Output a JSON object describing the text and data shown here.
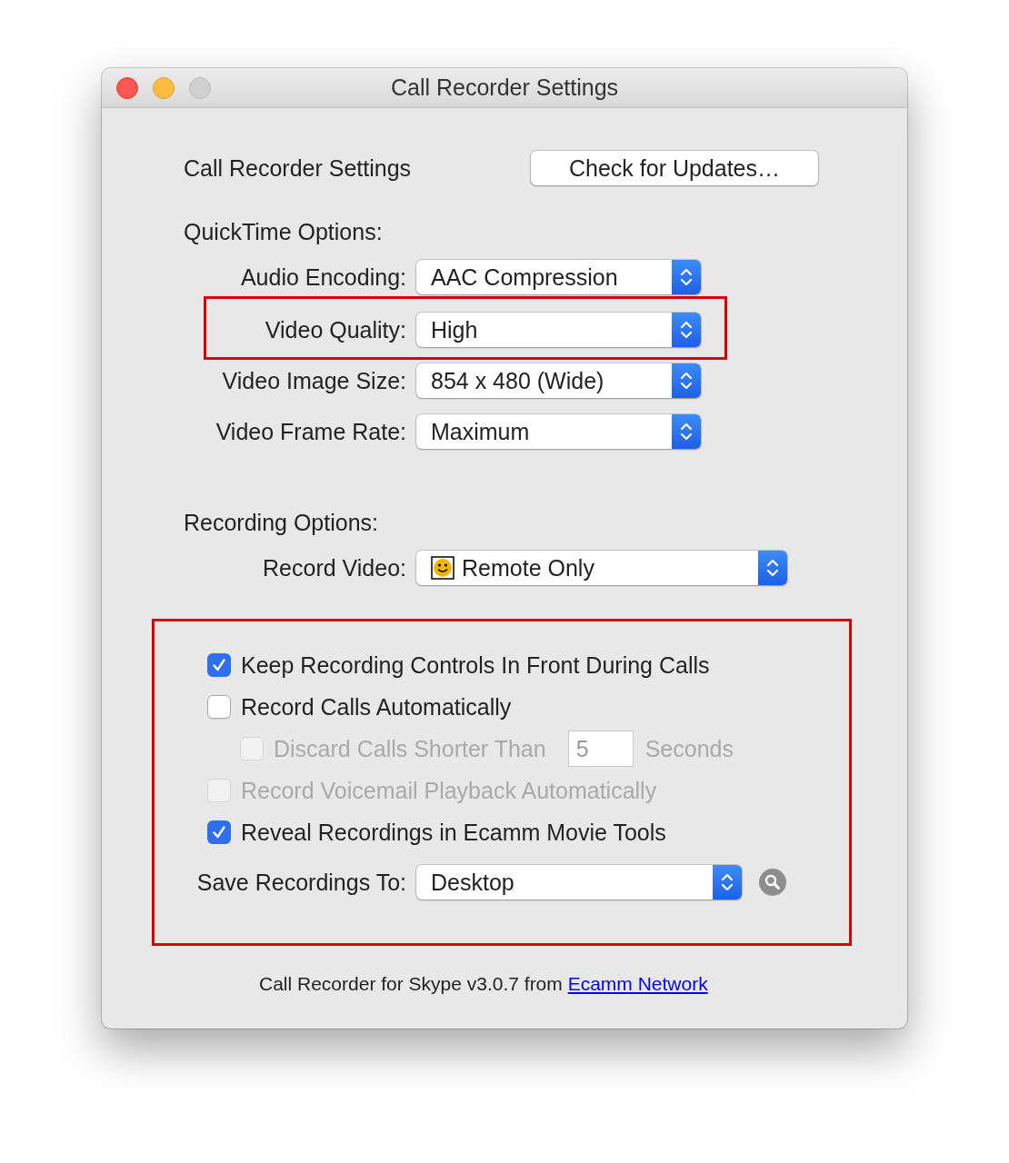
{
  "window": {
    "title": "Call Recorder Settings"
  },
  "header": {
    "label": "Call Recorder Settings",
    "button": "Check for Updates…"
  },
  "quicktime": {
    "heading": "QuickTime Options:",
    "rows": [
      {
        "label": "Audio Encoding:",
        "value": "AAC Compression",
        "highlighted": false
      },
      {
        "label": "Video Quality:",
        "value": "High",
        "highlighted": true
      },
      {
        "label": "Video Image Size:",
        "value": "854 x 480 (Wide)",
        "highlighted": false
      },
      {
        "label": "Video Frame Rate:",
        "value": "Maximum",
        "highlighted": false
      }
    ]
  },
  "recording": {
    "heading": "Recording Options:",
    "record_video": {
      "label": "Record Video:",
      "value": "Remote Only"
    }
  },
  "options": {
    "highlighted": true,
    "checkboxes": [
      {
        "label": "Keep Recording Controls In Front During Calls",
        "checked": true,
        "disabled": false
      },
      {
        "label": "Record Calls Automatically",
        "checked": false,
        "disabled": false,
        "children": [
          {
            "label": "Discard Calls Shorter Than",
            "checked": false,
            "disabled": true,
            "field": "5",
            "suffix": "Seconds"
          }
        ]
      },
      {
        "label": "Record Voicemail Playback Automatically",
        "checked": false,
        "disabled": true
      },
      {
        "label": "Reveal Recordings in Ecamm Movie Tools",
        "checked": true,
        "disabled": false
      }
    ],
    "save": {
      "label": "Save Recordings To:",
      "value": "Desktop"
    }
  },
  "footer": {
    "text": "Call Recorder for Skype v3.0.7 from",
    "link": "Ecamm Network"
  }
}
